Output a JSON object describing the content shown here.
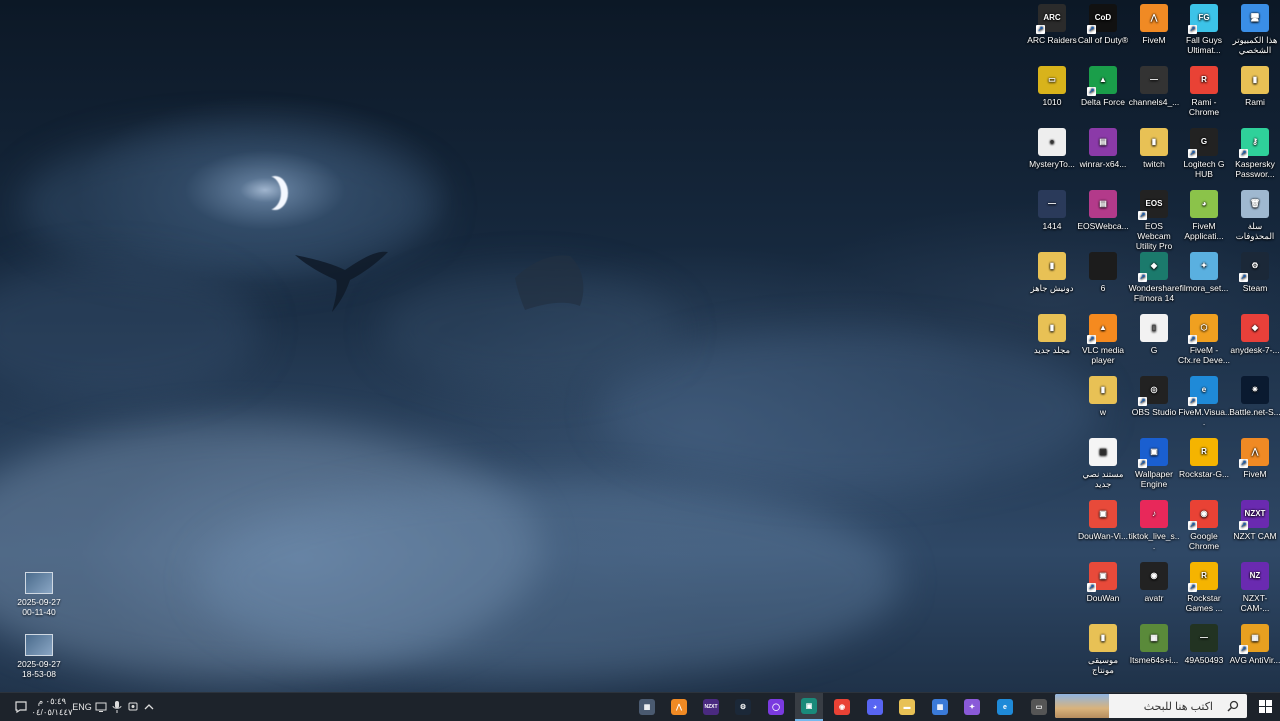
{
  "desktop_icons": [
    {
      "label": "ARC Raiders",
      "color": "#2b2b2b",
      "glyph": "ARC",
      "shortcut": true
    },
    {
      "label": "Call of Duty®",
      "color": "#111111",
      "glyph": "CoD",
      "shortcut": true
    },
    {
      "label": "FiveM",
      "color": "#f08a24",
      "glyph": "⋀",
      "shortcut": false
    },
    {
      "label": "Fall Guys Ultimat...",
      "color": "#3cc3e8",
      "glyph": "FG",
      "shortcut": true
    },
    {
      "label": "هذا الكمبيوتر الشخصي",
      "color": "#3a8ee6",
      "glyph": "🖥",
      "shortcut": false
    },
    {
      "label": "1010",
      "color": "#d8b31b",
      "glyph": "▭",
      "shortcut": false
    },
    {
      "label": "Delta Force",
      "color": "#1a9e4a",
      "glyph": "▲",
      "shortcut": true
    },
    {
      "label": "channels4_...",
      "color": "#333333",
      "glyph": "—",
      "shortcut": false
    },
    {
      "label": "Rami - Chrome",
      "color": "#e94235",
      "glyph": "R",
      "shortcut": false
    },
    {
      "label": "Rami",
      "color": "#e8c155",
      "glyph": "▮",
      "shortcut": false
    },
    {
      "label": "MysteryTo...",
      "color": "#eeeeee",
      "glyph": "●",
      "shortcut": false
    },
    {
      "label": "winrar-x64...",
      "color": "#8b3aa8",
      "glyph": "▤",
      "shortcut": false
    },
    {
      "label": "twitch",
      "color": "#e8c155",
      "glyph": "▮",
      "shortcut": false
    },
    {
      "label": "Logitech G HUB",
      "color": "#222222",
      "glyph": "G",
      "shortcut": true
    },
    {
      "label": "Kaspersky Passwor...",
      "color": "#2fd19a",
      "glyph": "⚷",
      "shortcut": true
    },
    {
      "label": "1414",
      "color": "#2a3a5a",
      "glyph": "—",
      "shortcut": false
    },
    {
      "label": "EOSWebca...",
      "color": "#b33a8a",
      "glyph": "▤",
      "shortcut": false
    },
    {
      "label": "EOS Webcam Utility Pro",
      "color": "#222222",
      "glyph": "EOS",
      "shortcut": true
    },
    {
      "label": "FiveM Applicati...",
      "color": "#8bc34a",
      "glyph": "◕",
      "shortcut": false
    },
    {
      "label": "سلة المحذوفات",
      "color": "#9fb8d0",
      "glyph": "🗑",
      "shortcut": false
    },
    {
      "label": "دونيش جاهز",
      "color": "#e8c155",
      "glyph": "▮",
      "shortcut": false
    },
    {
      "label": "6",
      "color": "#1c1c1c",
      "glyph": "",
      "shortcut": false
    },
    {
      "label": "Wondershare Filmora 14",
      "color": "#1b7a6c",
      "glyph": "◆",
      "shortcut": true
    },
    {
      "label": "filmora_set...",
      "color": "#5ab0e0",
      "glyph": "✦",
      "shortcut": false
    },
    {
      "label": "Steam",
      "color": "#1b2838",
      "glyph": "⚙",
      "shortcut": true
    },
    {
      "label": "مجلد جديد",
      "color": "#e8c155",
      "glyph": "▮",
      "shortcut": false
    },
    {
      "label": "VLC media player",
      "color": "#f58a1f",
      "glyph": "▲",
      "shortcut": true
    },
    {
      "label": "G",
      "color": "#f2f2f2",
      "glyph": "▯",
      "shortcut": false
    },
    {
      "label": "FiveM - Cfx.re Deve...",
      "color": "#f0a020",
      "glyph": "⬡",
      "shortcut": true
    },
    {
      "label": "anydesk-7-...",
      "color": "#e8403a",
      "glyph": "◆",
      "shortcut": false
    },
    {
      "label": "w",
      "color": "#e8c155",
      "glyph": "▮",
      "shortcut": false
    },
    {
      "label": "OBS Studio",
      "color": "#222222",
      "glyph": "◎",
      "shortcut": true
    },
    {
      "label": "FiveM.Visua...",
      "color": "#1f8ad8",
      "glyph": "e",
      "shortcut": true
    },
    {
      "label": "Battle.net-S...",
      "color": "#0a1a30",
      "glyph": "✷",
      "shortcut": false
    },
    {
      "label": "مستند نصي جديد",
      "color": "#f5f5f5",
      "glyph": "▤",
      "shortcut": false
    },
    {
      "label": "Wallpaper Engine",
      "color": "#1a5fd0",
      "glyph": "▣",
      "shortcut": true
    },
    {
      "label": "Rockstar-G...",
      "color": "#f5b400",
      "glyph": "R",
      "shortcut": false
    },
    {
      "label": "FiveM",
      "color": "#f08a24",
      "glyph": "⋀",
      "shortcut": true
    },
    {
      "label": "DouWan-Vi...",
      "color": "#e84a3a",
      "glyph": "▣",
      "shortcut": false
    },
    {
      "label": "tiktok_live_s...",
      "color": "#e8285a",
      "glyph": "♪",
      "shortcut": false
    },
    {
      "label": "Google Chrome",
      "color": "#e94235",
      "glyph": "◉",
      "shortcut": true
    },
    {
      "label": "NZXT CAM",
      "color": "#6a2ab0",
      "glyph": "NZXT",
      "shortcut": true
    },
    {
      "label": "DouWan",
      "color": "#e84a3a",
      "glyph": "▣",
      "shortcut": true
    },
    {
      "label": "avatr",
      "color": "#222222",
      "glyph": "◉",
      "shortcut": false
    },
    {
      "label": "Rockstar Games ...",
      "color": "#f5b400",
      "glyph": "R",
      "shortcut": true
    },
    {
      "label": "NZXT-CAM-...",
      "color": "#6a2ab0",
      "glyph": "NZ",
      "shortcut": false
    },
    {
      "label": "موسيقى مونتاج",
      "color": "#e8c155",
      "glyph": "▮",
      "shortcut": false
    },
    {
      "label": "Itsme64s+i...",
      "color": "#5a8a3a",
      "glyph": "▦",
      "shortcut": false
    },
    {
      "label": "49A50493",
      "color": "#223322",
      "glyph": "—",
      "shortcut": false
    },
    {
      "label": "AVG AntiVir...",
      "color": "#e8a020",
      "glyph": "▦",
      "shortcut": true
    }
  ],
  "screenshots": [
    {
      "date": "2025-09-27",
      "time": "00-11-40"
    },
    {
      "date": "2025-09-27",
      "time": "18-53-08"
    }
  ],
  "taskbar": {
    "clock_time": "٠٥:٤٩ م",
    "clock_date": "٠٤/٠٥/١٤٤٧",
    "language": "ENG",
    "search_placeholder": "اكتب هنا للبحث",
    "apps": [
      {
        "name": "keyboard-tool",
        "glyph": "▦",
        "color": "#4a5a70"
      },
      {
        "name": "fivem",
        "glyph": "⋀",
        "color": "#f08a24"
      },
      {
        "name": "nzxt",
        "glyph": "NZXT",
        "color": "#4a2a80"
      },
      {
        "name": "steam",
        "glyph": "⚙",
        "color": "#1b2838"
      },
      {
        "name": "app-circle",
        "glyph": "◯",
        "color": "#7a3adf"
      },
      {
        "name": "active-app",
        "glyph": "▣",
        "color": "#1a8a7a"
      },
      {
        "name": "chrome-rami",
        "glyph": "◉",
        "color": "#e94235"
      },
      {
        "name": "discord",
        "glyph": "◕",
        "color": "#5865f2"
      },
      {
        "name": "file-explorer",
        "glyph": "▬",
        "color": "#e8c155"
      },
      {
        "name": "store",
        "glyph": "▦",
        "color": "#3a7ad8"
      },
      {
        "name": "copilot",
        "glyph": "✦",
        "color": "#8a5ad8"
      },
      {
        "name": "edge",
        "glyph": "e",
        "color": "#1f8ad8"
      },
      {
        "name": "task-view",
        "glyph": "▭",
        "color": "#555555"
      }
    ]
  }
}
